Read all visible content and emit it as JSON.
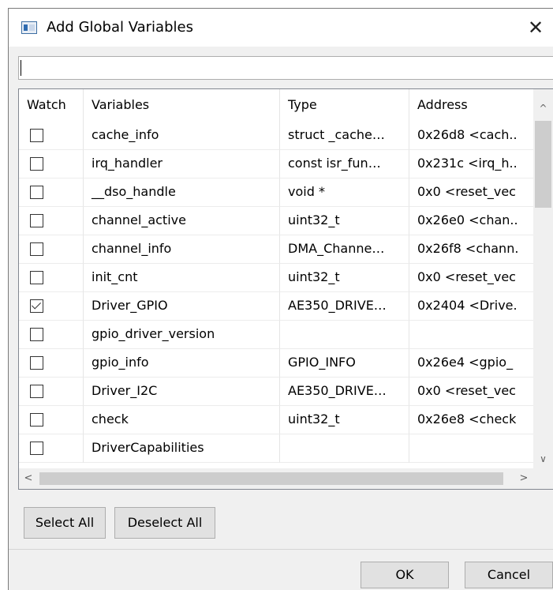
{
  "dialog": {
    "title": "Add Global Variables",
    "close_glyph": "✕"
  },
  "filter": {
    "value": ""
  },
  "table": {
    "headers": [
      "Watch",
      "Variables",
      "Type",
      "Address"
    ],
    "rows": [
      {
        "checked": false,
        "name": "cache_info",
        "type": "struct _cache…",
        "address": "0x26d8 <cach.."
      },
      {
        "checked": false,
        "name": "irq_handler",
        "type": "const isr_fun…",
        "address": "0x231c <irq_h.."
      },
      {
        "checked": false,
        "name": "__dso_handle",
        "type": "void *",
        "address": "0x0 <reset_vec"
      },
      {
        "checked": false,
        "name": "channel_active",
        "type": "uint32_t",
        "address": "0x26e0 <chan.."
      },
      {
        "checked": false,
        "name": "channel_info",
        "type": "DMA_Channe…",
        "address": "0x26f8 <chann."
      },
      {
        "checked": false,
        "name": "init_cnt",
        "type": "uint32_t",
        "address": "0x0 <reset_vec"
      },
      {
        "checked": true,
        "name": "Driver_GPIO",
        "type": "AE350_DRIVE…",
        "address": "0x2404 <Drive."
      },
      {
        "checked": false,
        "name": "gpio_driver_version",
        "type": "",
        "address": ""
      },
      {
        "checked": false,
        "name": "gpio_info",
        "type": "GPIO_INFO",
        "address": "0x26e4 <gpio_"
      },
      {
        "checked": false,
        "name": "Driver_I2C",
        "type": "AE350_DRIVE…",
        "address": "0x0 <reset_vec"
      },
      {
        "checked": false,
        "name": "check",
        "type": "uint32_t",
        "address": "0x26e8 <check"
      },
      {
        "checked": false,
        "name": "DriverCapabilities",
        "type": "",
        "address": ""
      }
    ]
  },
  "buttons": {
    "select_all": "Select All",
    "deselect_all": "Deselect All",
    "ok": "OK",
    "cancel": "Cancel"
  },
  "icons": {
    "app": "app-window-icon",
    "close": "close-icon",
    "scroll_up": "chevron-up-icon",
    "scroll_down": "chevron-down-icon",
    "scroll_left": "chevron-left-icon",
    "scroll_right": "chevron-right-icon"
  }
}
